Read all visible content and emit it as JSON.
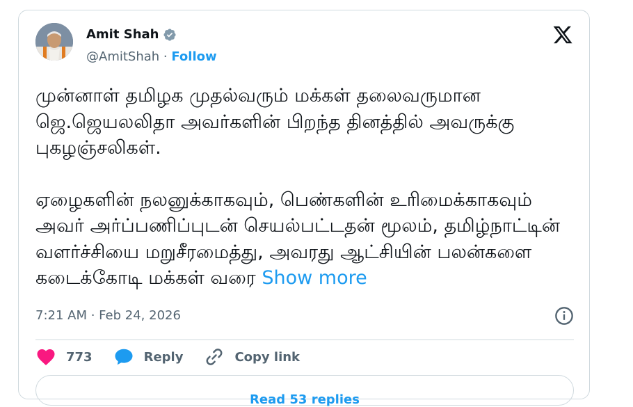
{
  "author": {
    "name": "Amit Shah",
    "handle": "@AmitShah",
    "separator": " · ",
    "follow_label": "Follow"
  },
  "tweet": {
    "paragraph1": "முன்னாள் தமிழக முதல்வரும் மக்கள் தலைவருமான ஜெ.ஜெயலலிதா அவர்களின் பிறந்த தினத்தில் அவருக்கு புகழஞ்சலிகள்.",
    "paragraph2": "ஏழைகளின் நலனுக்காகவும், பெண்களின் உரிமைக்காகவும் அவர் அர்ப்பணிப்புடன் செயல்பட்டதன் மூலம், தமிழ்நாட்டின் வளர்ச்சியை மறுசீரமைத்து, அவரது ஆட்சியின் பலன்களை கடைக்கோடி மக்கள் வரை",
    "show_more_label": "Show more"
  },
  "meta": {
    "time": "7:21 AM",
    "dot": " · ",
    "date": "Feb 24, 2026"
  },
  "actions": {
    "like_count": "773",
    "reply_label": "Reply",
    "copy_link_label": "Copy link"
  },
  "read_replies_label": "Read 53 replies",
  "icons": {
    "like": "heart-icon",
    "reply": "speech-bubble-icon",
    "copy": "link-icon",
    "info": "info-icon",
    "brand": "x-logo-icon",
    "verified": "verified-badge-icon"
  },
  "colors": {
    "accent": "#1d9bf0",
    "like": "#f91880",
    "text": "#0f1419",
    "muted": "#536471",
    "border": "#cfd9de"
  }
}
